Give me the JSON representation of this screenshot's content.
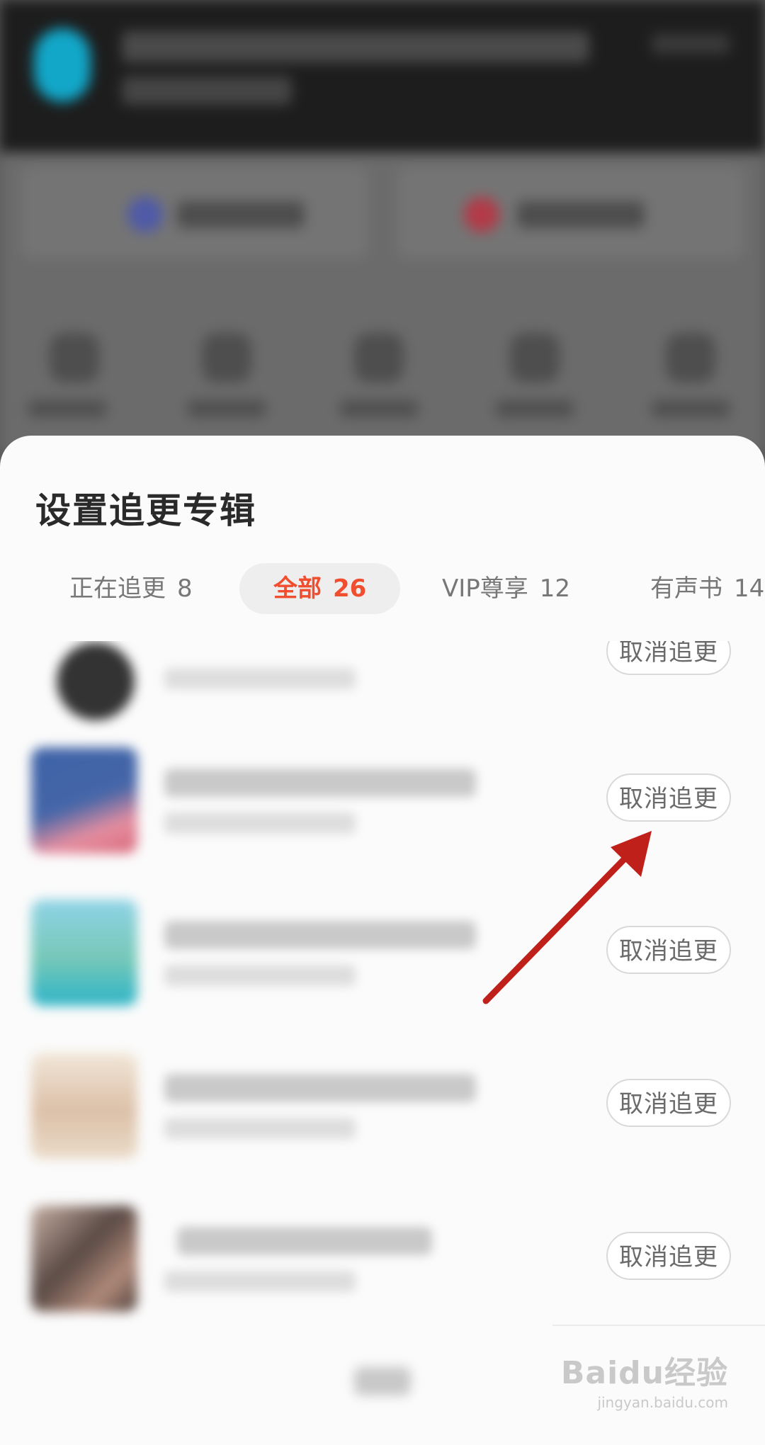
{
  "sheet": {
    "title": "设置追更专辑",
    "tabs": [
      {
        "label": "正在追更",
        "count": "8",
        "active": false
      },
      {
        "label": "全部",
        "count": "26",
        "active": true
      },
      {
        "label": "VIP尊享",
        "count": "12",
        "active": false
      },
      {
        "label": "有声书",
        "count": "14",
        "active": false
      }
    ],
    "rows": [
      {
        "thumbnail_colors": [
          "#4a4a4a",
          "#2f2f2f"
        ],
        "action_label": "取消追更"
      },
      {
        "thumbnail_colors": [
          "#3f63a8",
          "#e58ea0"
        ],
        "action_label": "取消追更"
      },
      {
        "thumbnail_colors": [
          "#7ecde0",
          "#31b7c9"
        ],
        "action_label": "取消追更"
      },
      {
        "thumbnail_colors": [
          "#eadbc8",
          "#d9bfa6"
        ],
        "action_label": "取消追更"
      },
      {
        "thumbnail_colors": [
          "#a98b7c",
          "#5a4a45"
        ],
        "action_label": "取消追更"
      }
    ]
  },
  "annotation": {
    "arrow_color": "#c0201a"
  },
  "watermark": {
    "brand": "Baidu经验",
    "url": "jingyan.baidu.com"
  },
  "colors": {
    "accent": "#f04e2e"
  }
}
